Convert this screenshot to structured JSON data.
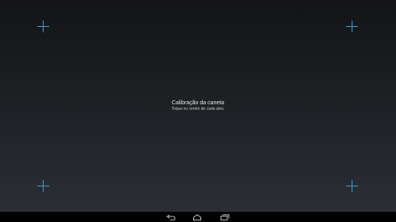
{
  "calibration": {
    "title": "Calibração da caneta",
    "instruction": "Toque no centro de cada alvo."
  },
  "colors": {
    "target": "#2fa3e6",
    "background_top": "#131416",
    "background_bottom": "#2b2f34",
    "navbar": "#000000"
  },
  "targets": [
    "crosshair-icon",
    "crosshair-icon",
    "crosshair-icon",
    "crosshair-icon"
  ],
  "navbar": {
    "icons": [
      "back-icon",
      "home-icon",
      "recent-apps-icon"
    ]
  }
}
